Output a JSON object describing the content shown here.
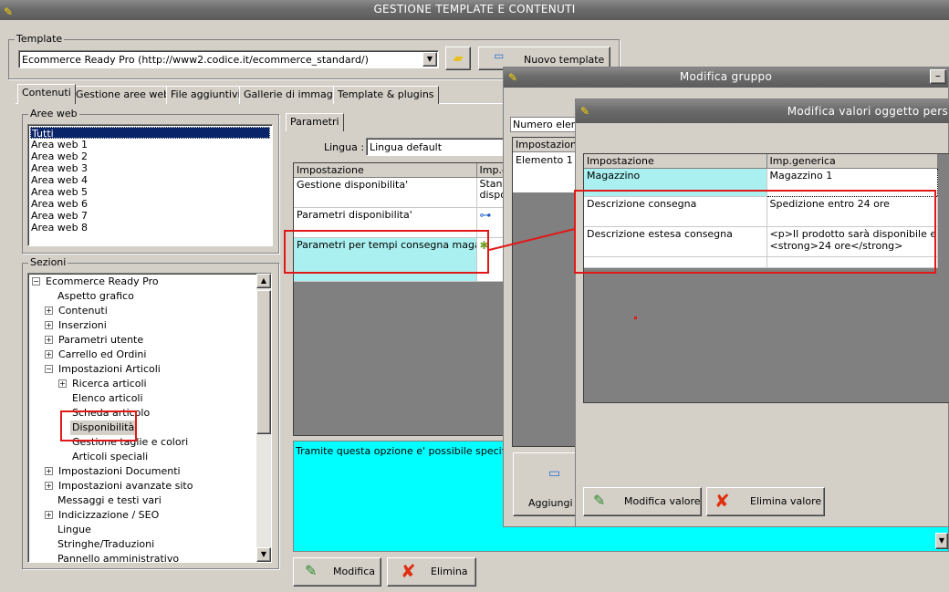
{
  "main_title": "GESTIONE TEMPLATE E CONTENUTI",
  "template": {
    "label": "Template",
    "selected": "Ecommerce Ready Pro (http://www2.codice.it/ecommerce_standard/)",
    "new_button": "Nuovo template"
  },
  "tabs": [
    "Contenuti",
    "Gestione aree web",
    "File aggiuntivi",
    "Gallerie di immagini",
    "Template & plugins"
  ],
  "aree_web": {
    "label": "Aree web",
    "items": [
      "Tutti",
      "Area web 1",
      "Area web 2",
      "Area web 3",
      "Area web 4",
      "Area web 5",
      "Area web 6",
      "Area web 7",
      "Area web 8"
    ]
  },
  "sezioni": {
    "label": "Sezioni",
    "root": "Ecommerce Ready Pro",
    "items": [
      "Aspetto grafico",
      "Contenuti",
      "Inserzioni",
      "Parametri utente",
      "Carrello ed Ordini",
      "Impostazioni Articoli",
      "Ricerca articoli",
      "Elenco articoli",
      "Scheda articolo",
      "Disponibilità",
      "Gestione taglie e colori",
      "Articoli speciali",
      "Impostazioni Documenti",
      "Impostazioni avanzate sito",
      "Messaggi e testi vari",
      "Indicizzazione / SEO",
      "Lingue",
      "Stringhe/Traduzioni",
      "Pannello amministrativo"
    ]
  },
  "parametri": {
    "tab": "Parametri",
    "lingua_label": "Lingua :",
    "lingua_value": "Lingua default",
    "col_impostazione": "Impostazione",
    "col_imp": "Imp.g",
    "rows": [
      {
        "name": "Gestione disponibilita'",
        "value": "Stand",
        "value2": "dispo"
      },
      {
        "name": "Parametri disponibilita'",
        "value": ""
      },
      {
        "name": "Parametri per tempi consegna magazzini",
        "value": ""
      }
    ],
    "description": "Tramite questa opzione e' possibile specificare i",
    "modifica": "Modifica",
    "elimina": "Elimina"
  },
  "modifica_gruppo": {
    "title": "Modifica gruppo",
    "numero_label": "Numero elemen",
    "col": "Impostazione",
    "row": "Elemento 1",
    "aggiungi": "Aggiungi (F"
  },
  "modifica_valori": {
    "title": "Modifica valori oggetto pers",
    "col_impostazione": "Impostazione",
    "col_imp": "Imp.generica",
    "rows": [
      {
        "name": "Magazzino",
        "value": "Magazzino 1",
        "value2": ""
      },
      {
        "name": "Descrizione consegna",
        "value": "Spedizione entro 24 ore",
        "value2": ""
      },
      {
        "name": "Descrizione estesa consegna",
        "value": "<p>Il prodotto sarà disponibile entro",
        "value2": "<strong>24 ore</strong>"
      }
    ],
    "modifica_valore": "Modifica valore",
    "elimina_valore": "Elimina valore"
  },
  "colors": {
    "highlight": "#e01818",
    "cyan": "#00ffff",
    "selection": "#0a246a"
  }
}
